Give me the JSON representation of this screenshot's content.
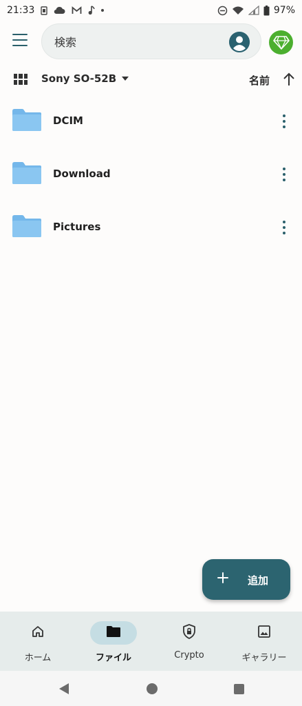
{
  "status_bar": {
    "time": "21:33",
    "battery": "97%",
    "left_icons": [
      "sim-card-icon",
      "cloud-icon",
      "gmail-icon",
      "music-note-icon",
      "notification-dot-icon"
    ],
    "right_icons": [
      "do-not-disturb-icon",
      "wifi-icon",
      "signal-icon",
      "battery-icon"
    ]
  },
  "app_bar": {
    "search_placeholder": "検索",
    "icons": {
      "menu": "menu-icon",
      "account": "account-circle-icon",
      "premium": "diamond-icon"
    },
    "colors": {
      "accent": "#2a5f6b",
      "premium_bg": "#4caf2f"
    }
  },
  "toolbar": {
    "location": "Sony SO-52B",
    "sort_label": "名前",
    "sort_direction": "ascending"
  },
  "files": [
    {
      "name": "DCIM",
      "type": "folder"
    },
    {
      "name": "Download",
      "type": "folder"
    },
    {
      "name": "Pictures",
      "type": "folder"
    }
  ],
  "fab": {
    "label": "追加",
    "color": "#2c6470"
  },
  "bottom_nav": {
    "items": [
      {
        "label": "ホーム",
        "icon": "home-icon",
        "active": false
      },
      {
        "label": "ファイル",
        "icon": "folder-icon",
        "active": true
      },
      {
        "label": "Crypto",
        "icon": "shield-lock-icon",
        "active": false
      },
      {
        "label": "ギャラリー",
        "icon": "image-icon",
        "active": false
      }
    ]
  },
  "colors": {
    "folder": "#7cbcec",
    "nav_background": "#e6eceb",
    "nav_active_pill": "#c5dde3"
  }
}
